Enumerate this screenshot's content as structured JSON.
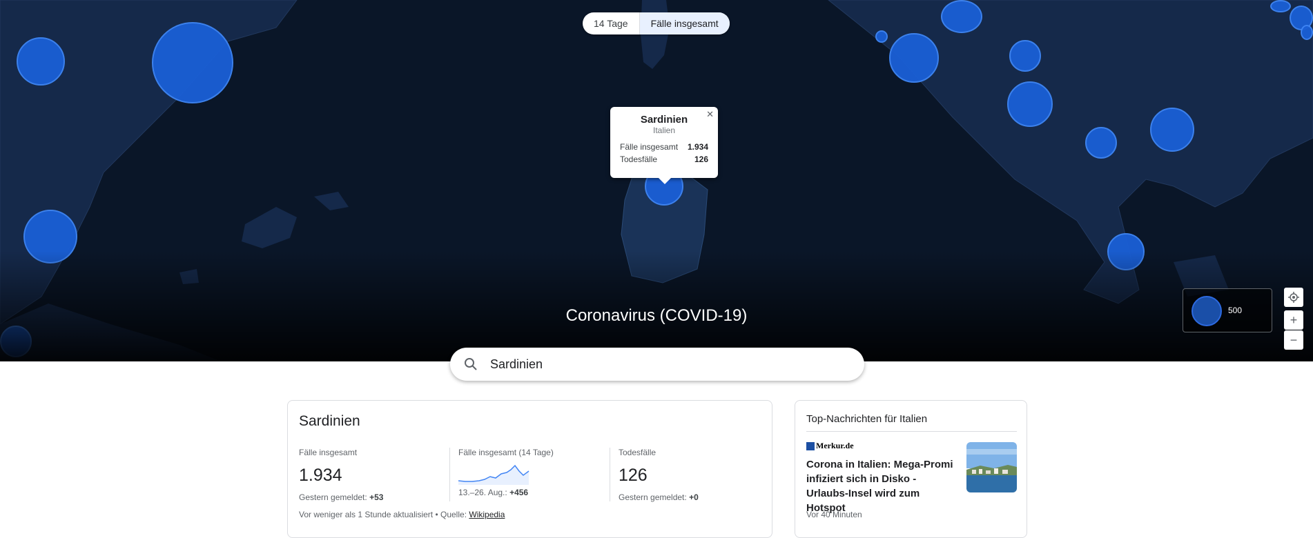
{
  "toggle": {
    "option_14": "14 Tage",
    "option_total": "Fälle insgesamt"
  },
  "map": {
    "title": "Coronavirus (COVID-19)",
    "popup": {
      "title": "Sardinien",
      "subtitle": "Italien",
      "rows": [
        {
          "label": "Fälle insgesamt",
          "value": "1.934"
        },
        {
          "label": "Todesfälle",
          "value": "126"
        }
      ]
    },
    "legend_value": "500",
    "colors": {
      "bubble": "#1a5fd6",
      "land": "#15294a",
      "sea": "#0a1628"
    }
  },
  "search": {
    "value": "Sardinien"
  },
  "stats": {
    "title": "Sardinien",
    "total": {
      "label": "Fälle insgesamt",
      "value": "1.934",
      "note_label": "Gestern gemeldet:",
      "note_value": "+53"
    },
    "trend": {
      "label": "Fälle insgesamt (14 Tage)",
      "note_label": "13.–26. Aug.:",
      "note_value": "+456"
    },
    "deaths": {
      "label": "Todesfälle",
      "value": "126",
      "note_label": "Gestern gemeldet:",
      "note_value": "+0"
    },
    "footer_updated": "Vor weniger als 1 Stunde aktualisiert",
    "footer_source_label": "Quelle:",
    "footer_source_link": "Wikipedia"
  },
  "news": {
    "title": "Top-Nachrichten für Italien",
    "source": "Merkur.de",
    "headline": "Corona in Italien: Mega-Promi infiziert sich in Disko - Urlaubs-Insel wird zum Hotspot",
    "time": "Vor 40 Minuten"
  }
}
